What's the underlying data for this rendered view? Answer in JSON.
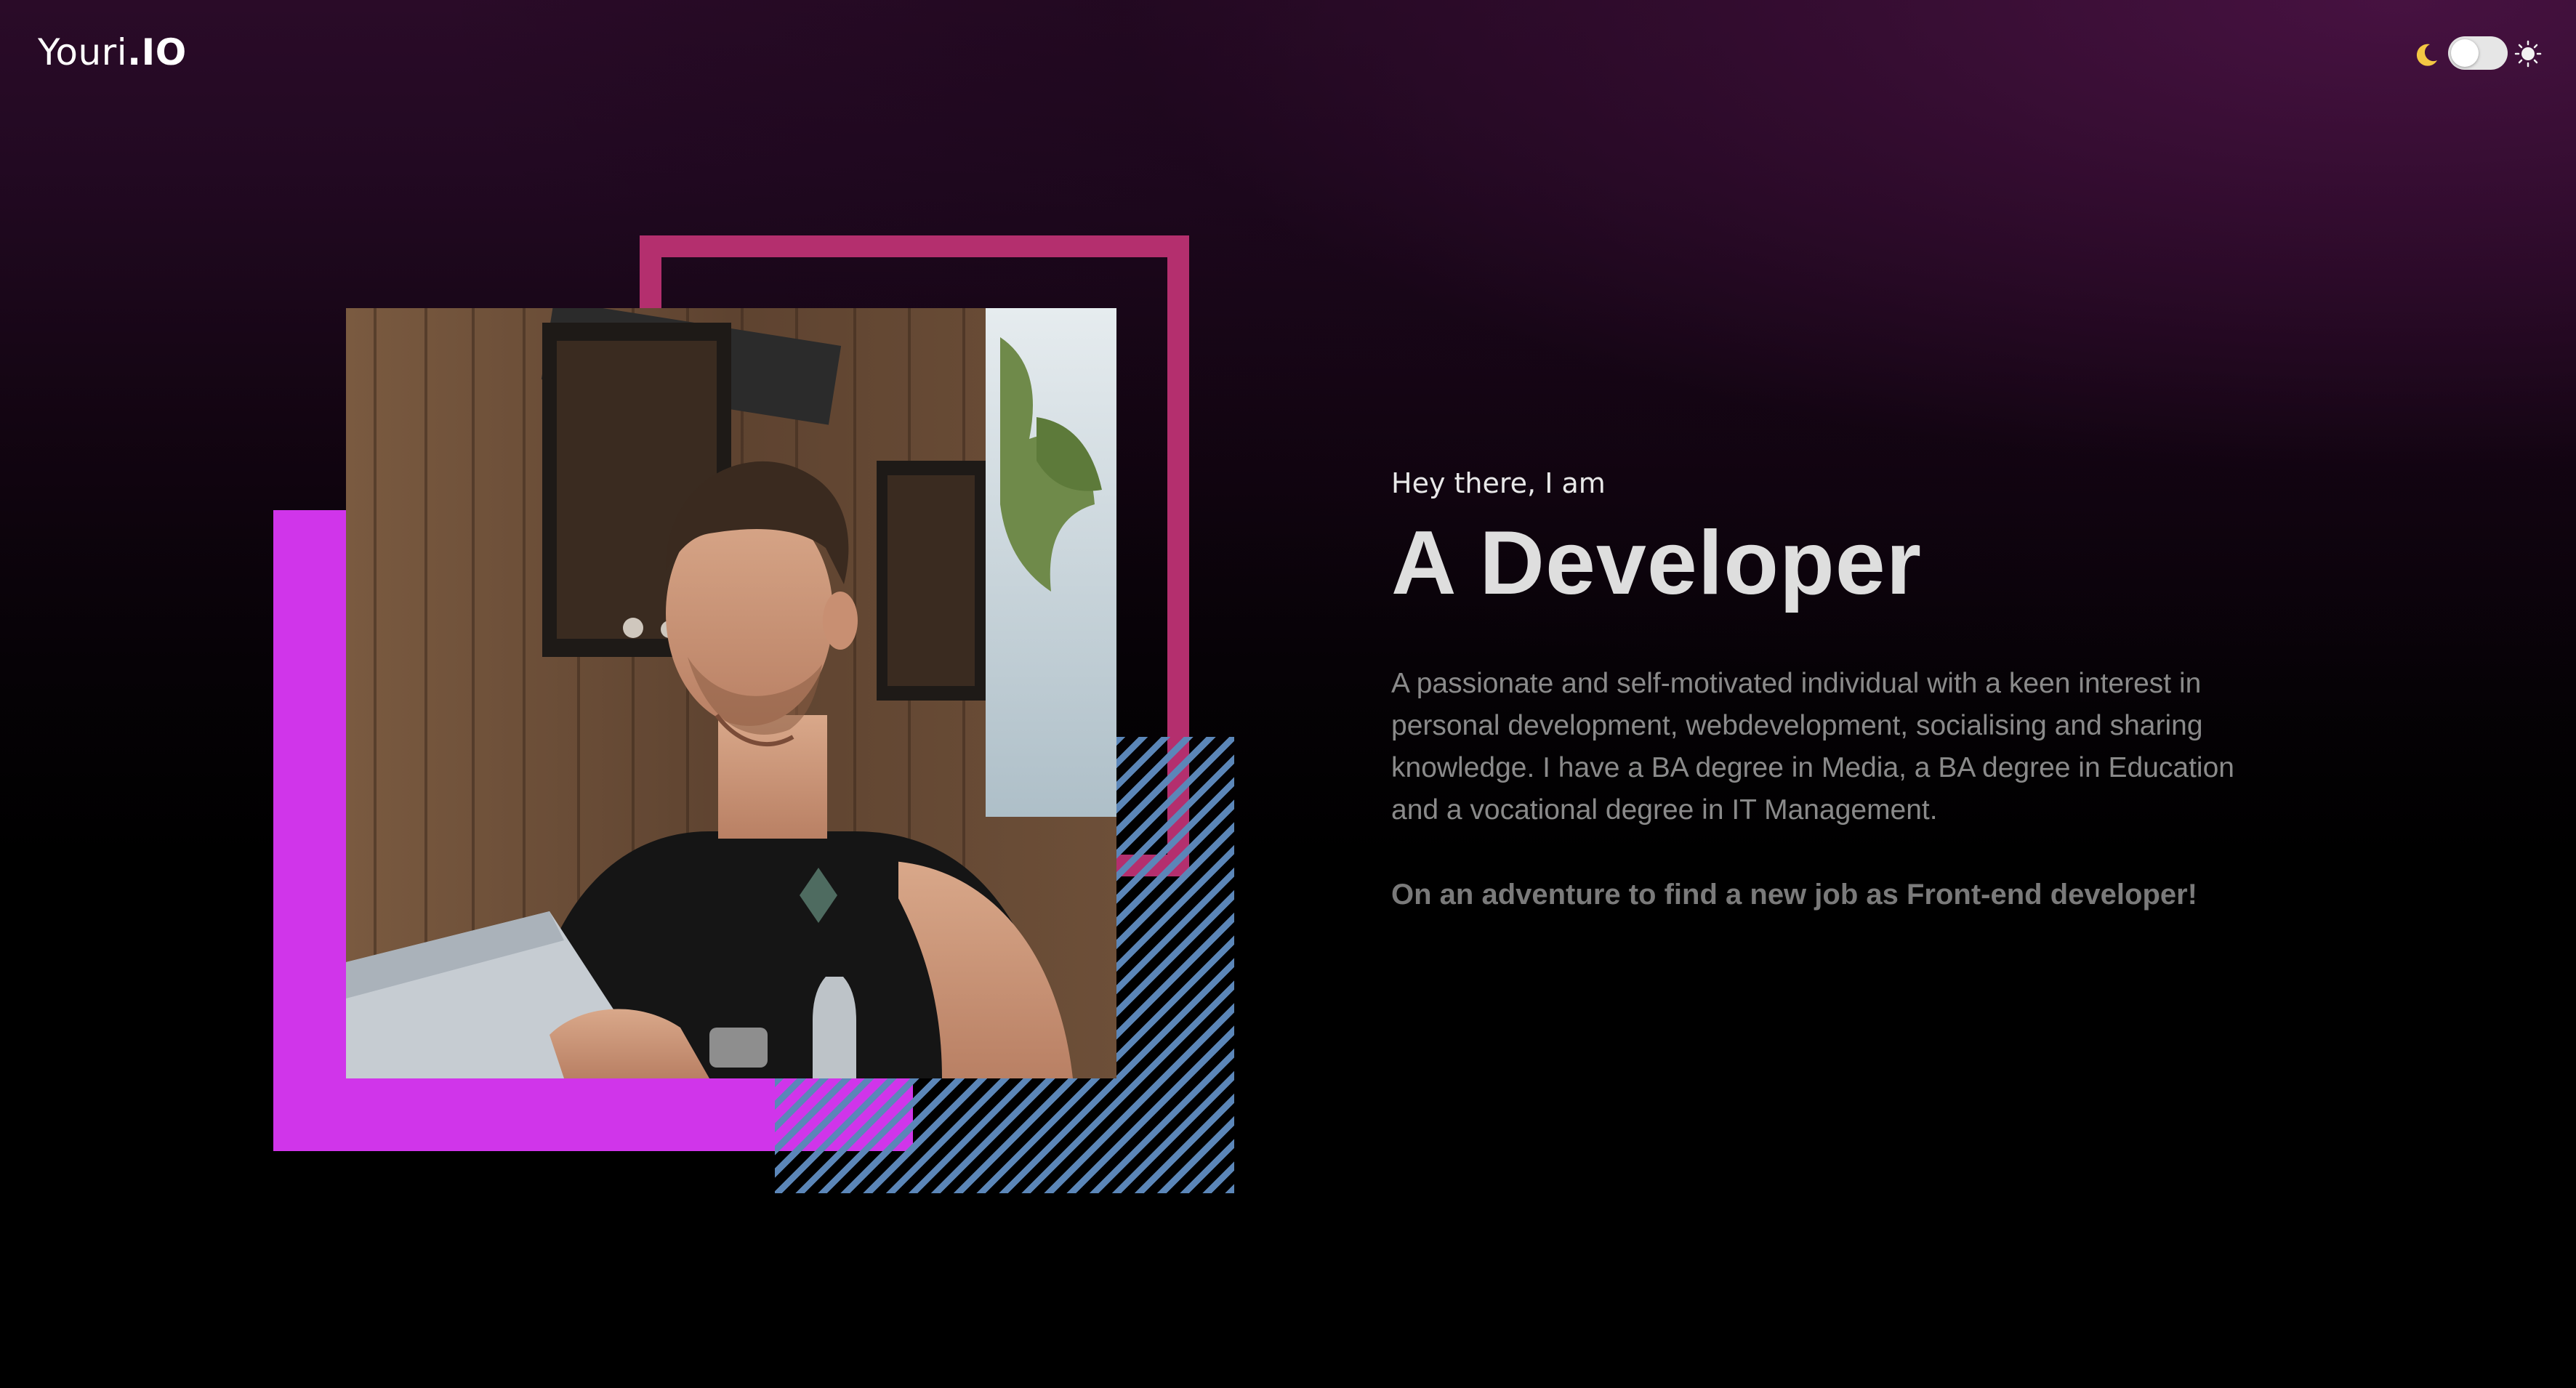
{
  "header": {
    "logo_name": "Youri",
    "logo_tld": ".IO",
    "theme_toggle": {
      "moon_icon": "moon-icon",
      "sun_icon": "sun-icon",
      "mode": "dark"
    }
  },
  "hero": {
    "image_alt": "Portrait of the developer sitting at a laptop in a café",
    "accent_colors": {
      "frame": "#b42f6e",
      "block": "#d035ea",
      "stripes": "#5b86b8"
    }
  },
  "intro": {
    "greeting": "Hey there, I am",
    "headline": "A Developer",
    "bio": "A passionate and self-motivated individual with a keen interest in personal development, webdevelopment, socialising and sharing knowledge. I have a BA degree in Media, a BA degree in Education and a vocational degree in IT Management.",
    "tagline": "On an adventure to find a new job as Front-end developer!"
  }
}
